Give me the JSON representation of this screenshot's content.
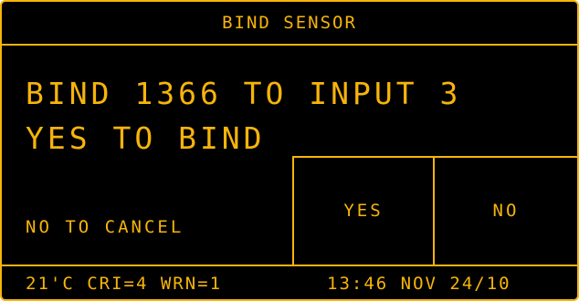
{
  "header": {
    "title": "BIND SENSOR"
  },
  "message": {
    "line1": "BIND 1366 TO INPUT 3",
    "line2": "YES TO BIND",
    "cancel_hint": "NO TO CANCEL"
  },
  "buttons": {
    "yes_label": "YES",
    "no_label": "NO"
  },
  "status_bar": {
    "left_text": "21'C CRI=4 WRN=1",
    "datetime": "13:46 NOV 24/10"
  },
  "colors": {
    "foreground": "#f7b40a",
    "background": "#000000"
  }
}
